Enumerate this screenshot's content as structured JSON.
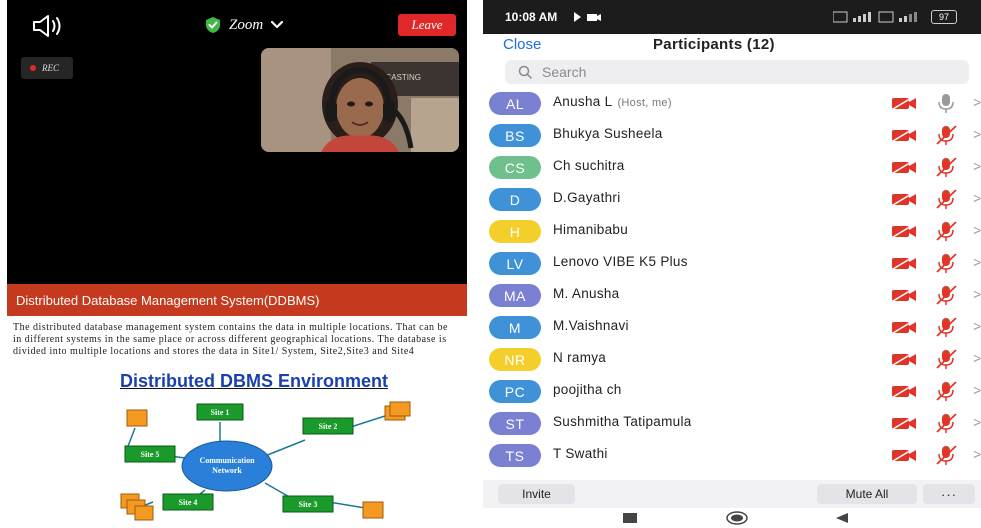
{
  "meeting": {
    "app_name": "Zoom",
    "leave_label": "Leave",
    "rec_label": "REC",
    "video_overlay_text": "LE-CASTING",
    "share_title": "Distributed Database Management System(DDBMS)",
    "slide_text": "The distributed database management system contains the data in multiple locations. That can be in different systems in the same place or across different geographical locations. The database is divided into multiple locations and stores the data in Site1/ System, Site2,Site3 and Site4",
    "slide_heading": "Distributed DBMS Environment",
    "diagram": {
      "center_label_line1": "Communication",
      "center_label_line2": "Network",
      "sites": [
        "Site 1",
        "Site 2",
        "Site 3",
        "Site 4",
        "Site 5"
      ]
    }
  },
  "phone": {
    "time": "10:08 AM",
    "battery": "97",
    "close_label": "Close",
    "title": "Participants (12)",
    "search_placeholder": "Search",
    "participants": [
      {
        "initials": "AL",
        "name": "Anusha L",
        "tag": "(Host, me)",
        "color": "#7a80d2"
      },
      {
        "initials": "BS",
        "name": "Bhukya Susheela",
        "tag": "",
        "color": "#3f92d8"
      },
      {
        "initials": "CS",
        "name": "Ch suchitra",
        "tag": "",
        "color": "#6fc08c"
      },
      {
        "initials": "D",
        "name": "D.Gayathri",
        "tag": "",
        "color": "#3f92d8"
      },
      {
        "initials": "H",
        "name": "Himanibabu",
        "tag": "",
        "color": "#f4cf2c"
      },
      {
        "initials": "LV",
        "name": "Lenovo VIBE K5 Plus",
        "tag": "",
        "color": "#3f92d8"
      },
      {
        "initials": "MA",
        "name": "M. Anusha",
        "tag": "",
        "color": "#7a80d2"
      },
      {
        "initials": "M",
        "name": "M.Vaishnavi",
        "tag": "",
        "color": "#3f92d8"
      },
      {
        "initials": "NR",
        "name": "N ramya",
        "tag": "",
        "color": "#f4cf2c"
      },
      {
        "initials": "PC",
        "name": "poojitha ch",
        "tag": "",
        "color": "#3f92d8"
      },
      {
        "initials": "ST",
        "name": "Sushmitha Tatipamula",
        "tag": "",
        "color": "#7a80d2"
      },
      {
        "initials": "TS",
        "name": "T Swathi",
        "tag": "",
        "color": "#7a80d2"
      }
    ],
    "invite_label": "Invite",
    "mute_all_label": "Mute All",
    "more_label": "···"
  },
  "colors": {
    "accent_blue": "#1a70e0",
    "leave_red": "#e02828",
    "share_bar": "#c53a1e",
    "muted_red": "#e0362a"
  },
  "icons": {
    "speaker": "speaker-icon",
    "shield": "shield-check-icon",
    "search": "search-icon",
    "camera_off": "camera-off-icon",
    "mic_off": "mic-off-icon",
    "mic": "mic-icon",
    "chevron": "chevron-right-icon"
  }
}
